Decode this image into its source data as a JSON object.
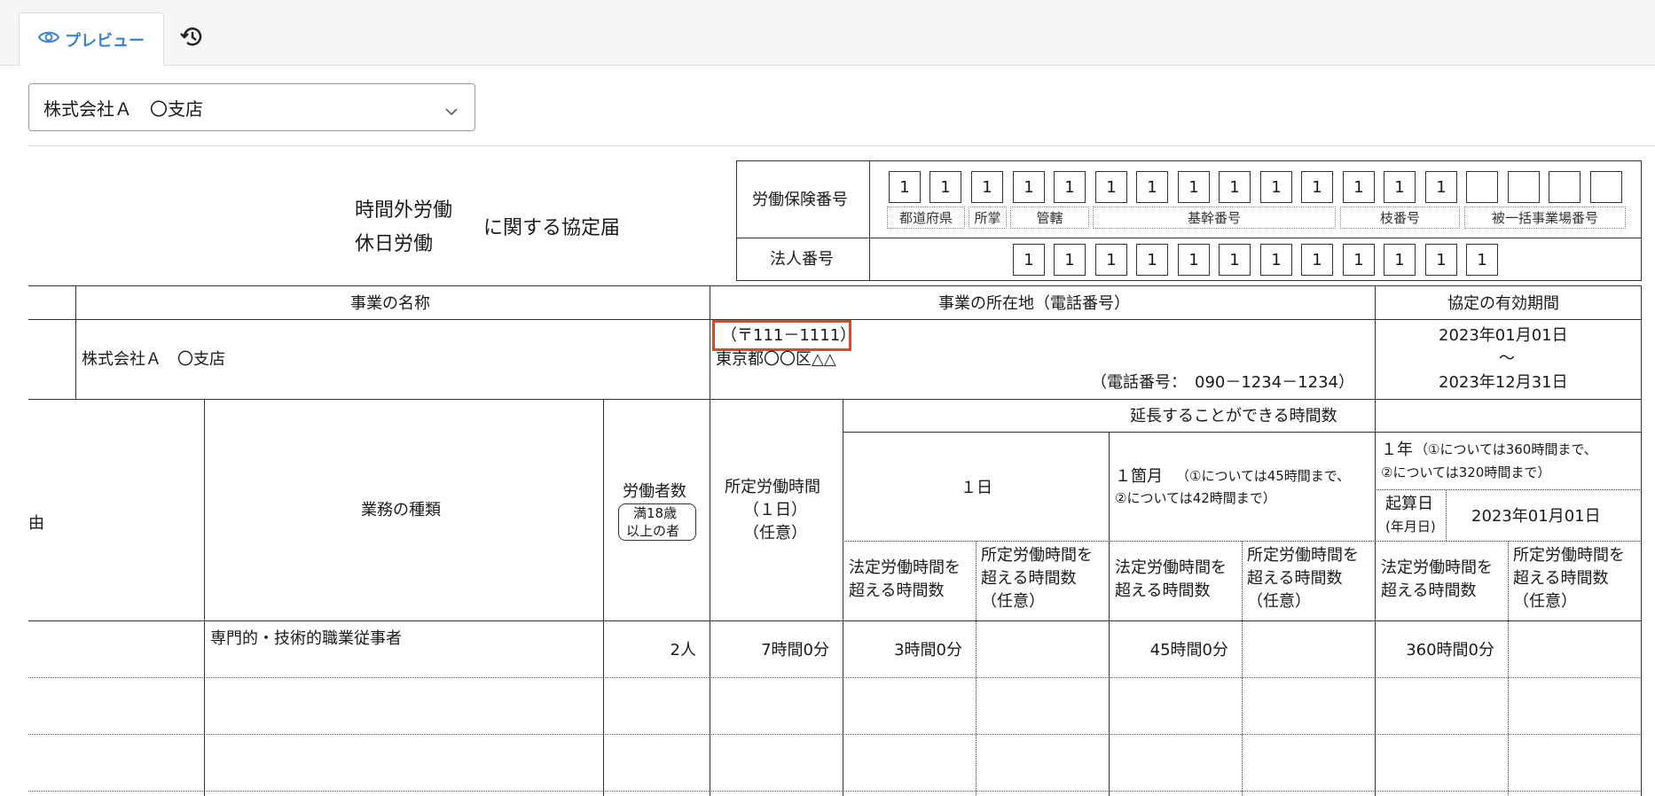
{
  "tabs": {
    "preview_label": "プレビュー"
  },
  "company_select": {
    "value": "株式会社Ａ　〇支店"
  },
  "form": {
    "title_line1": "時間外労働",
    "title_line2": "休日労働",
    "title_suffix": "に関する協定届",
    "insurance_label": "労働保険番号",
    "insurance_digits": [
      "1",
      "1",
      "1",
      "1",
      "1",
      "1",
      "1",
      "1",
      "1",
      "1",
      "1",
      "1",
      "1",
      "1",
      "",
      "",
      "",
      ""
    ],
    "insurance_parts": [
      "都道府県",
      "所掌",
      "管轄",
      "基幹番号",
      "枝番号",
      "被一括事業場番号"
    ],
    "corporate_label": "法人番号",
    "corporate_digits": [
      "1",
      "1",
      "1",
      "1",
      "1",
      "1",
      "1",
      "1",
      "1",
      "1",
      "1",
      "1"
    ],
    "business_name_header": "事業の名称",
    "business_location_header": "事業の所在地（電話番号）",
    "validity_header": "協定の有効期間",
    "business_name": "株式会社Ａ　〇支店",
    "postal_code": "（〒111－1111）",
    "address": "東京都〇〇区△△",
    "phone": "（電話番号：　090－1234－1234）",
    "validity_start": "2023年01月01日",
    "validity_tilde": "～",
    "validity_end": "2023年12月31日",
    "reason_header": "由",
    "work_type_header": "業務の種類",
    "workers_header": "労働者数",
    "workers_note_line1": "満18歳",
    "workers_note_line2": "以上の者",
    "prescribed_hours_line1": "所定労働時間",
    "prescribed_hours_line2": "（１日）",
    "prescribed_hours_line3": "（任意）",
    "extendable_header": "延長することができる時間数",
    "day_header": "１日",
    "month_header": "１箇月",
    "month_note_line1": "（①については45時間まで、",
    "month_note_line2": "②については42時間まで）",
    "year_header": "１年",
    "year_note_line1": "（①については360時間まで、",
    "year_note_line2": "②については320時間まで）",
    "base_date_label_line1": "起算日",
    "base_date_label_line2": "(年月日)",
    "base_date": "2023年01月01日",
    "legal_over_line1": "法定労働時間を",
    "legal_over_line2": "超える時間数",
    "prescribed_over_line1": "所定労働時間を",
    "prescribed_over_line2": "超える時間数",
    "prescribed_over_line3": "（任意）",
    "row1": {
      "work_type": "専門的・技術的職業従事者",
      "workers": "2人",
      "prescribed_hours": "7時間0分",
      "day_legal": "3時間0分",
      "month_legal": "45時間0分",
      "year_legal": "360時間0分"
    }
  }
}
